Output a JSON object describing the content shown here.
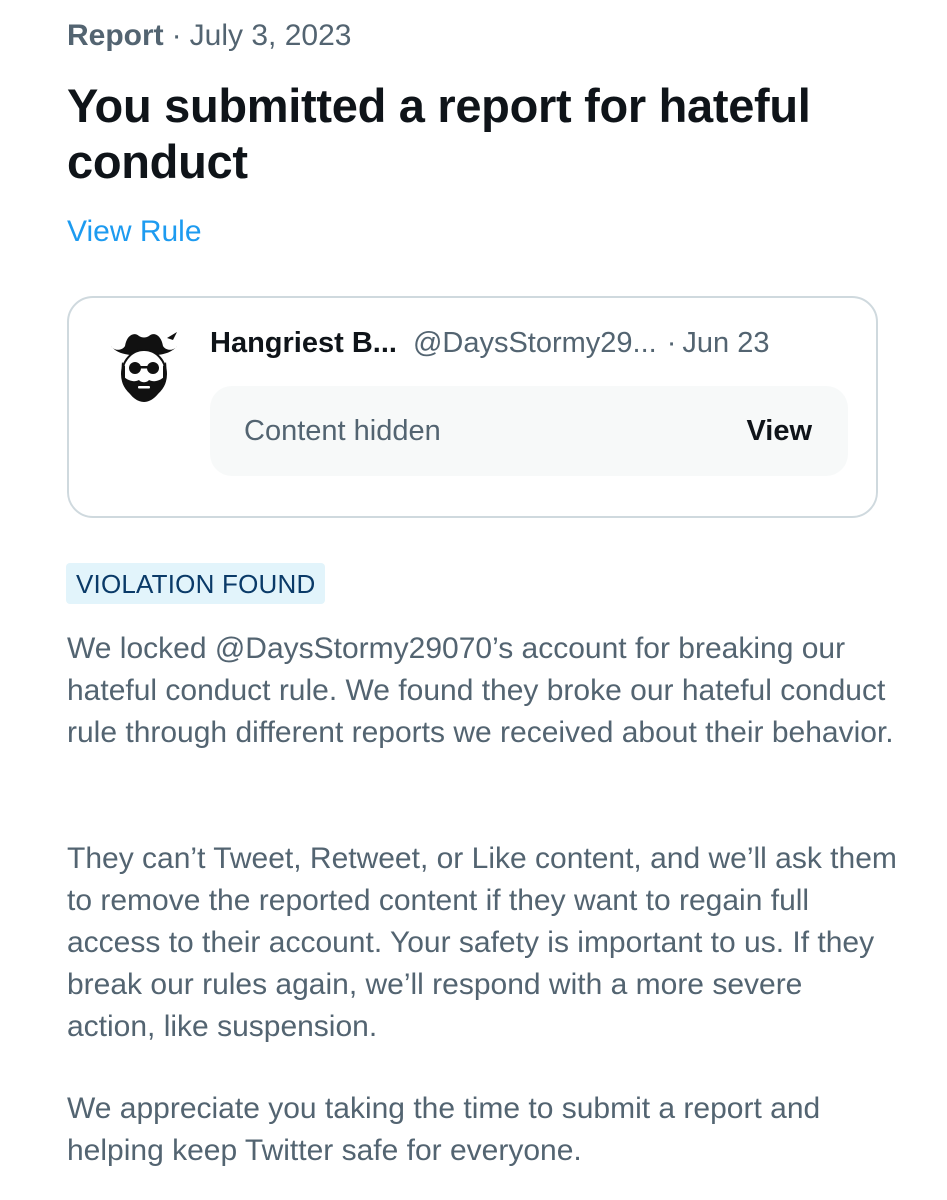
{
  "header": {
    "kind": "Report",
    "separator": "·",
    "date": "July 3, 2023",
    "title": "You submitted a report for hateful conduct",
    "view_rule_label": "View Rule"
  },
  "reported_tweet": {
    "display_name": "Hangriest B...",
    "handle": "@DaysStormy29...",
    "separator": "·",
    "date": "Jun 23",
    "avatar_icon": "cowboy-hat-bearded-face-avatar-icon",
    "hidden_label": "Content hidden",
    "view_label": "View"
  },
  "status": {
    "badge": "VIOLATION FOUND",
    "badge_color": "#e2f4fb",
    "badge_text_color": "#0a3a68"
  },
  "paragraphs": [
    "We locked @DaysStormy29070’s account for breaking our hateful conduct rule. We found they broke our hateful conduct rule through different reports we received about their behavior.",
    "They can’t Tweet, Retweet, or Like content, and we’ll ask them to remove the reported content if they want to regain full access to their account. Your safety is important to us. If they break our rules again, we’ll respond with a more severe action, like suspension.",
    "We appreciate you taking the time to submit a report and helping keep Twitter safe for everyone."
  ],
  "colors": {
    "link": "#1d9bf0",
    "secondary_text": "#536471",
    "primary_text": "#0f1419",
    "card_border": "#cfd9de",
    "hidden_box_bg": "#f7f9f9"
  }
}
